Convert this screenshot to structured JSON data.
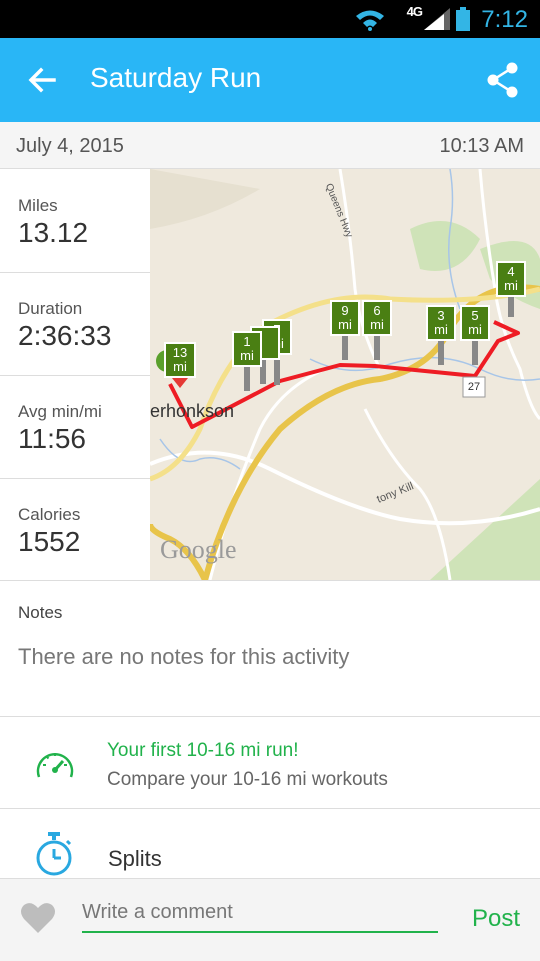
{
  "status_bar": {
    "time": "7:12",
    "network": "4G"
  },
  "app_bar": {
    "title": "Saturday Run"
  },
  "activity": {
    "date": "July 4, 2015",
    "time": "10:13 AM"
  },
  "stats": [
    {
      "label": "Miles",
      "value": "13.12"
    },
    {
      "label": "Duration",
      "value": "2:36:33"
    },
    {
      "label": "Avg min/mi",
      "value": "11:56"
    },
    {
      "label": "Calories",
      "value": "1552"
    }
  ],
  "map": {
    "town_label": "erhonkson",
    "road_labels": {
      "queens_hwy": "Queens Hwy",
      "stony_kill": "tony Kill",
      "route": "27"
    },
    "watermark": "Google",
    "markers": [
      {
        "num": "13",
        "unit": "mi"
      },
      {
        "num": "1",
        "unit": "mi"
      },
      {
        "num": "7",
        "unit": "mi"
      },
      {
        "num": "9",
        "unit": "mi"
      },
      {
        "num": "6",
        "unit": "mi"
      },
      {
        "num": "3",
        "unit": "mi"
      },
      {
        "num": "5",
        "unit": "mi"
      },
      {
        "num": "4",
        "unit": "mi"
      }
    ]
  },
  "notes": {
    "heading": "Notes",
    "text": "There are no notes for this activity"
  },
  "achievement": {
    "title": "Your first 10-16 mi run!",
    "subtitle": "Compare your 10-16 mi workouts"
  },
  "splits": {
    "label": "Splits"
  },
  "comment": {
    "placeholder": "Write a comment",
    "post_label": "Post"
  },
  "colors": {
    "app_bar": "#29b6f6",
    "accent_green": "#21b24b",
    "route_red": "#ee1c24",
    "marker_green": "#4a7f13"
  }
}
